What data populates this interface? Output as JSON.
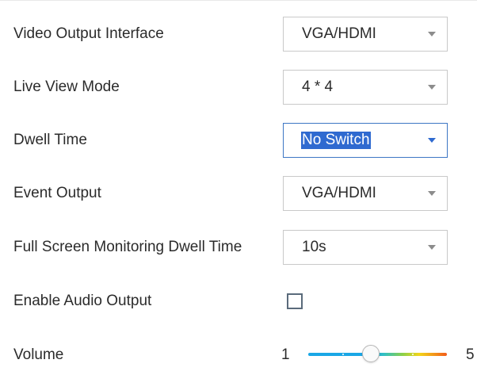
{
  "settings": {
    "video_output_interface": {
      "label": "Video Output Interface",
      "value": "VGA/HDMI"
    },
    "live_view_mode": {
      "label": "Live View Mode",
      "value": "4 * 4"
    },
    "dwell_time": {
      "label": "Dwell Time",
      "value": "No Switch"
    },
    "event_output": {
      "label": "Event Output",
      "value": "VGA/HDMI"
    },
    "full_screen_dwell_time": {
      "label": "Full Screen Monitoring Dwell Time",
      "value": "10s"
    },
    "enable_audio_output": {
      "label": "Enable Audio Output",
      "checked": false
    },
    "volume": {
      "label": "Volume",
      "min_label": "1",
      "max_label": "5",
      "min": 1,
      "max": 5,
      "value": 2.8
    }
  },
  "colors": {
    "focus_border": "#3d76c4",
    "selection_highlight": "#2f6ad0",
    "slider_start": "#1aa7e6",
    "slider_end": "#f25b1a"
  },
  "icons": {
    "dropdown": "chevron-down-icon",
    "checkbox": "checkbox-unchecked-icon"
  }
}
